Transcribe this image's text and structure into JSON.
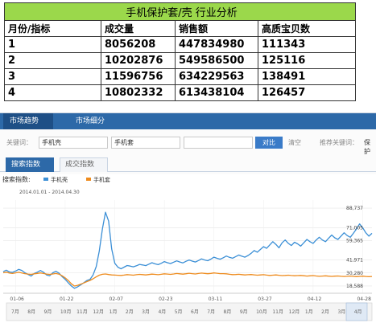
{
  "summary": {
    "title": "手机保护套/壳 行业分析",
    "headers": [
      "月份/指标",
      "成交量",
      "销售额",
      "高质宝贝数"
    ],
    "rows": [
      [
        "1",
        "8056208",
        "447834980",
        "111343"
      ],
      [
        "2",
        "10202876",
        "549586500",
        "125116"
      ],
      [
        "3",
        "11596756",
        "634229563",
        "138491"
      ],
      [
        "4",
        "10802332",
        "613438104",
        "126457"
      ]
    ]
  },
  "nav": {
    "tabs": [
      "市场趋势",
      "市场细分"
    ]
  },
  "search": {
    "keyword_label": "关键词：",
    "keyword1": "手机壳",
    "keyword2": "手机套",
    "compare_label": "对比",
    "clear_label": "清空",
    "recommend_label": "推荐关键词：",
    "recommend_value": "保护"
  },
  "subtabs": [
    "搜索指数",
    "成交指数"
  ],
  "colors": {
    "series1": "#3b8fd6",
    "series2": "#ee8b1d",
    "tabbar": "#2d69a8",
    "table_header": "#9bd84b"
  },
  "chart_data": {
    "type": "line",
    "title": "搜索指数:",
    "date_range": "2014.01.01 - 2014.04.30",
    "y_ticks": [
      "88,737",
      "71,005",
      "59,365",
      "41,971",
      "30,280",
      "18,588"
    ],
    "x_ticks": [
      "01-06",
      "01-22",
      "02-07",
      "02-23",
      "03-11",
      "03-27",
      "04-12",
      "04-28"
    ],
    "grid": true,
    "legend": "top-left",
    "series": [
      {
        "name": "手机壳",
        "values": [
          31500,
          32800,
          31200,
          30800,
          32000,
          33500,
          32600,
          30500,
          29000,
          27500,
          29800,
          31000,
          32500,
          31000,
          28500,
          27800,
          30500,
          31800,
          30200,
          27000,
          24500,
          21500,
          18500,
          16500,
          17800,
          19500,
          21500,
          23500,
          24500,
          28500,
          36000,
          50000,
          70000,
          85000,
          77000,
          52000,
          39000,
          35500,
          34000,
          35500,
          37000,
          36500,
          35800,
          36800,
          38000,
          37500,
          36900,
          38200,
          39500,
          38500,
          37800,
          39000,
          40500,
          39500,
          38800,
          40000,
          41200,
          40200,
          39400,
          40800,
          42000,
          41000,
          40200,
          41500,
          43000,
          42000,
          41300,
          42800,
          44500,
          43500,
          42700,
          44000,
          45500,
          44400,
          43600,
          45000,
          46500,
          45400,
          44500,
          46000,
          48000,
          50500,
          49000,
          51500,
          54000,
          52500,
          55500,
          58500,
          56000,
          53000,
          57500,
          60000,
          57000,
          55000,
          58000,
          56500,
          54500,
          57500,
          60500,
          58500,
          57000,
          60000,
          62500,
          60000,
          58500,
          61500,
          64500,
          62000,
          60500,
          63500,
          66500,
          64000,
          62500,
          66000,
          70000,
          74500,
          71000,
          66500,
          63500,
          66000
        ],
        "color": "#3b8fd6"
      },
      {
        "name": "手机套",
        "values": [
          30500,
          31000,
          30200,
          29800,
          30400,
          30900,
          30300,
          29700,
          29300,
          29000,
          29500,
          29900,
          30300,
          29800,
          29300,
          29000,
          29400,
          29800,
          29200,
          27800,
          25800,
          23500,
          20500,
          18500,
          19200,
          20200,
          21300,
          22500,
          23600,
          25000,
          26800,
          28300,
          29100,
          29400,
          28900,
          28500,
          28400,
          28200,
          28100,
          28400,
          28800,
          28600,
          28300,
          28700,
          29000,
          28800,
          28500,
          28900,
          29200,
          29000,
          28700,
          29100,
          29500,
          29300,
          29000,
          29400,
          29800,
          29500,
          29200,
          29600,
          30000,
          29700,
          29400,
          29800,
          30200,
          29900,
          29600,
          29900,
          30300,
          30000,
          29700,
          29700,
          29500,
          29100,
          28800,
          28900,
          29100,
          28800,
          28500,
          28700,
          28900,
          28600,
          28300,
          28500,
          28700,
          28400,
          28100,
          28300,
          28500,
          28200,
          27900,
          28100,
          28300,
          28000,
          27800,
          27900,
          28100,
          27800,
          27500,
          27700,
          27900,
          27600,
          27300,
          27500,
          27700,
          27400,
          27200,
          27400,
          27600,
          27300,
          27100,
          27300,
          27500,
          27200,
          27000,
          27200,
          27400,
          27100,
          26900,
          27100
        ],
        "color": "#ee8b1d"
      }
    ],
    "timeline_labels": [
      "7月",
      "8月",
      "9月",
      "10月",
      "11月",
      "12月",
      "1月",
      "2月",
      "3月",
      "4月",
      "5月",
      "6月",
      "7月",
      "8月",
      "9月",
      "10月",
      "11月",
      "12月",
      "1月",
      "2月",
      "3月",
      "4月"
    ]
  }
}
